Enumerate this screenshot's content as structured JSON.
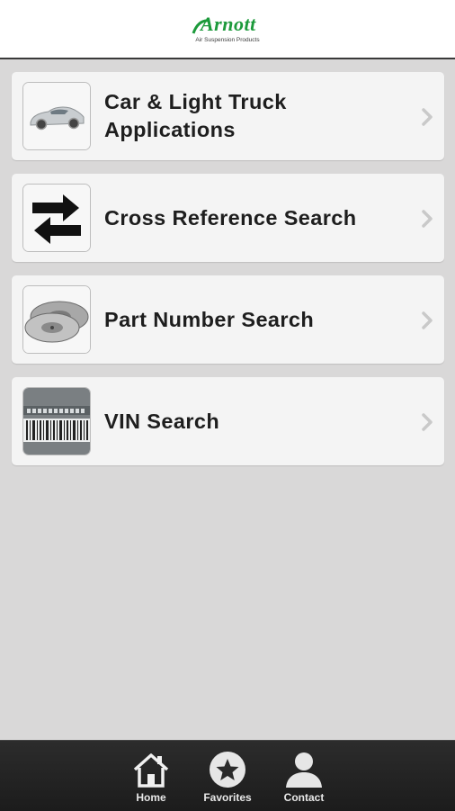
{
  "header": {
    "logo_brand": "Arnott",
    "logo_tagline": "Air Suspension Products",
    "brand_color": "#1c9a3b"
  },
  "menu": {
    "items": [
      {
        "label": "Car & Light Truck Applications",
        "icon": "car-icon"
      },
      {
        "label": "Cross Reference Search",
        "icon": "swap-arrows-icon"
      },
      {
        "label": "Part Number Search",
        "icon": "brake-disc-icon"
      },
      {
        "label": "VIN Search",
        "icon": "vin-barcode-icon"
      }
    ]
  },
  "tabbar": {
    "tabs": [
      {
        "label": "Home",
        "icon": "home-icon"
      },
      {
        "label": "Favorites",
        "icon": "star-icon"
      },
      {
        "label": "Contact",
        "icon": "person-icon"
      }
    ]
  }
}
